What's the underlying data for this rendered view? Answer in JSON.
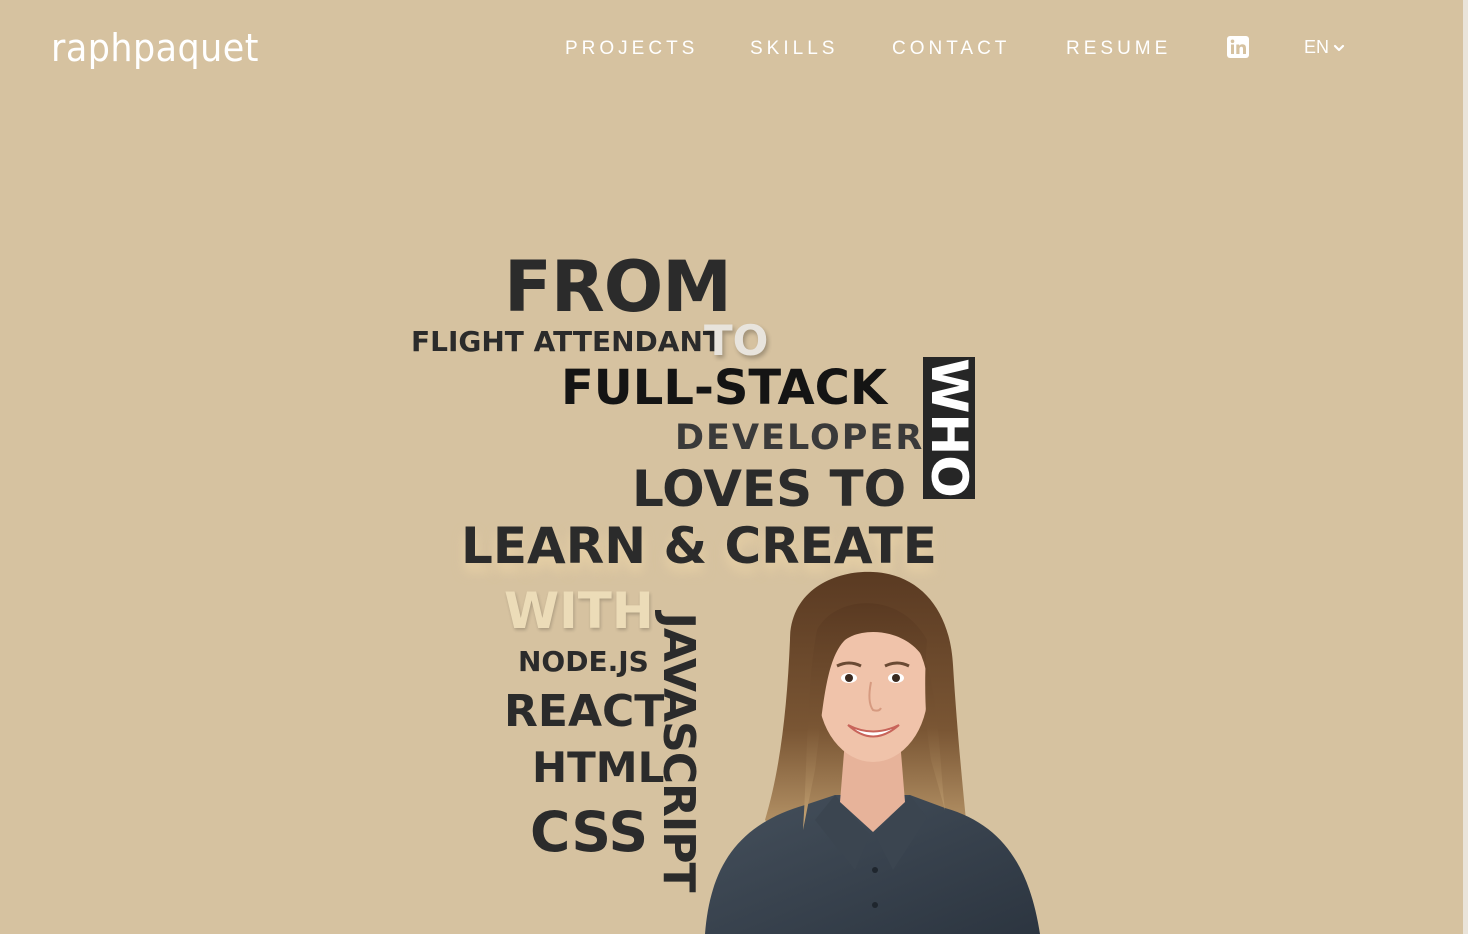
{
  "header": {
    "logo": "raphpaquet",
    "nav": {
      "projects": "PROJECTS",
      "skills": "SKILLS",
      "contact": "CONTACT",
      "resume": "RESUME"
    },
    "social_icon": "linkedin-icon",
    "language": "EN"
  },
  "hero": {
    "from": "FROM",
    "flight_attendant": "FLIGHT ATTENDANT",
    "to": "TO",
    "full_stack": "FULL-STACK",
    "developer": "DEVELOPER",
    "who": "WHO",
    "loves_to": "LOVES TO",
    "learn_create": "LEARN & CREATE",
    "with": "WITH",
    "javascript": "JAVASCRIPT",
    "node": "NODE.JS",
    "react": "REACT",
    "html": "HTML",
    "css": "CSS"
  },
  "colors": {
    "background": "#d6c2a0",
    "text_dark": "#2b2b2b",
    "nav_text": "#ffffff"
  }
}
